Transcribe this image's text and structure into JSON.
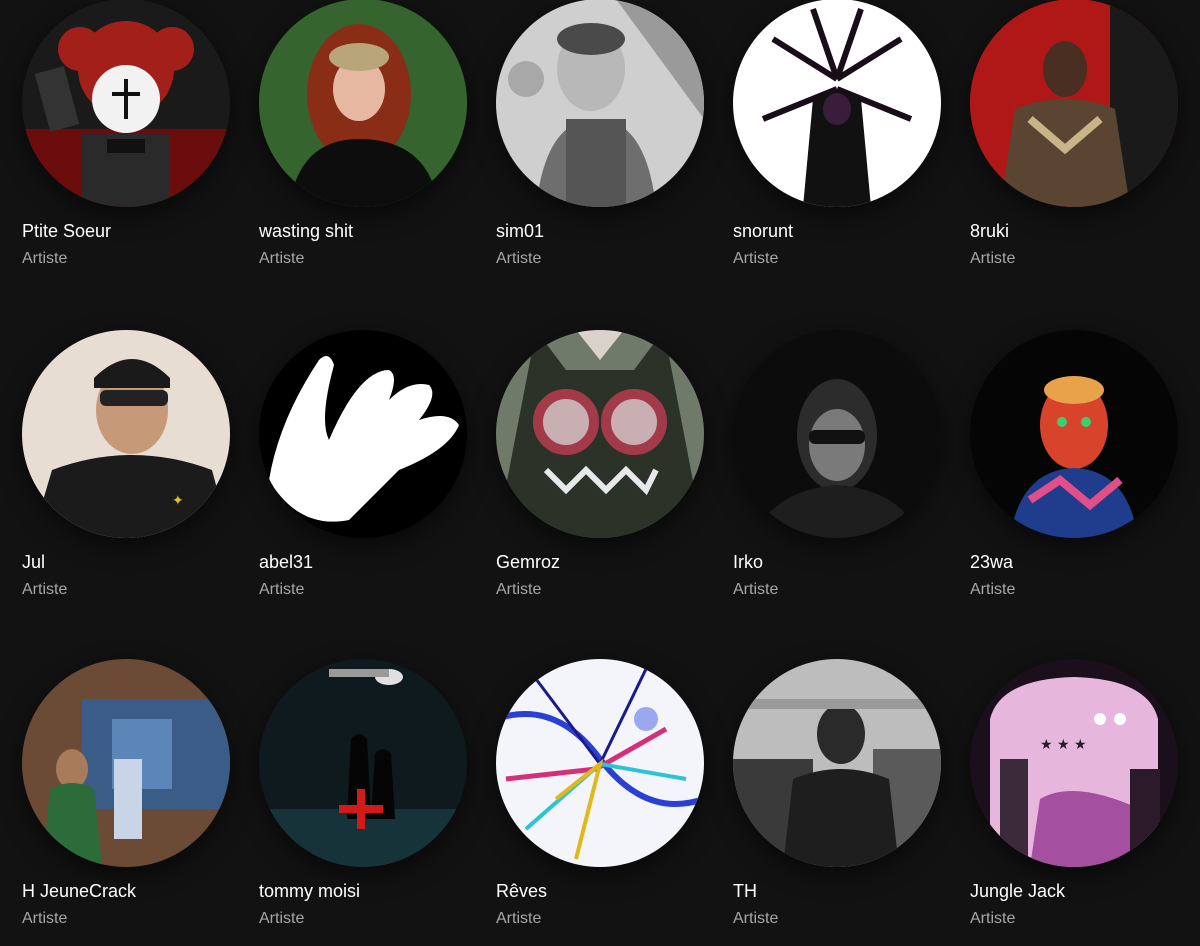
{
  "artists": [
    {
      "name": "Ptite Soeur",
      "subtitle": "Artiste"
    },
    {
      "name": "wasting shit",
      "subtitle": "Artiste"
    },
    {
      "name": "sim01",
      "subtitle": "Artiste"
    },
    {
      "name": "snorunt",
      "subtitle": "Artiste"
    },
    {
      "name": "8ruki",
      "subtitle": "Artiste"
    },
    {
      "name": "Jul",
      "subtitle": "Artiste"
    },
    {
      "name": "abel31",
      "subtitle": "Artiste"
    },
    {
      "name": "Gemroz",
      "subtitle": "Artiste"
    },
    {
      "name": "Irko",
      "subtitle": "Artiste"
    },
    {
      "name": "23wa",
      "subtitle": "Artiste"
    },
    {
      "name": "H JeuneCrack",
      "subtitle": "Artiste"
    },
    {
      "name": "tommy moisi",
      "subtitle": "Artiste"
    },
    {
      "name": "Rêves",
      "subtitle": "Artiste"
    },
    {
      "name": "TH",
      "subtitle": "Artiste"
    },
    {
      "name": "Jungle Jack",
      "subtitle": "Artiste"
    }
  ],
  "colors": {
    "background": "#121212",
    "name_text": "#ffffff",
    "subtitle_text": "#a7a7a7"
  }
}
